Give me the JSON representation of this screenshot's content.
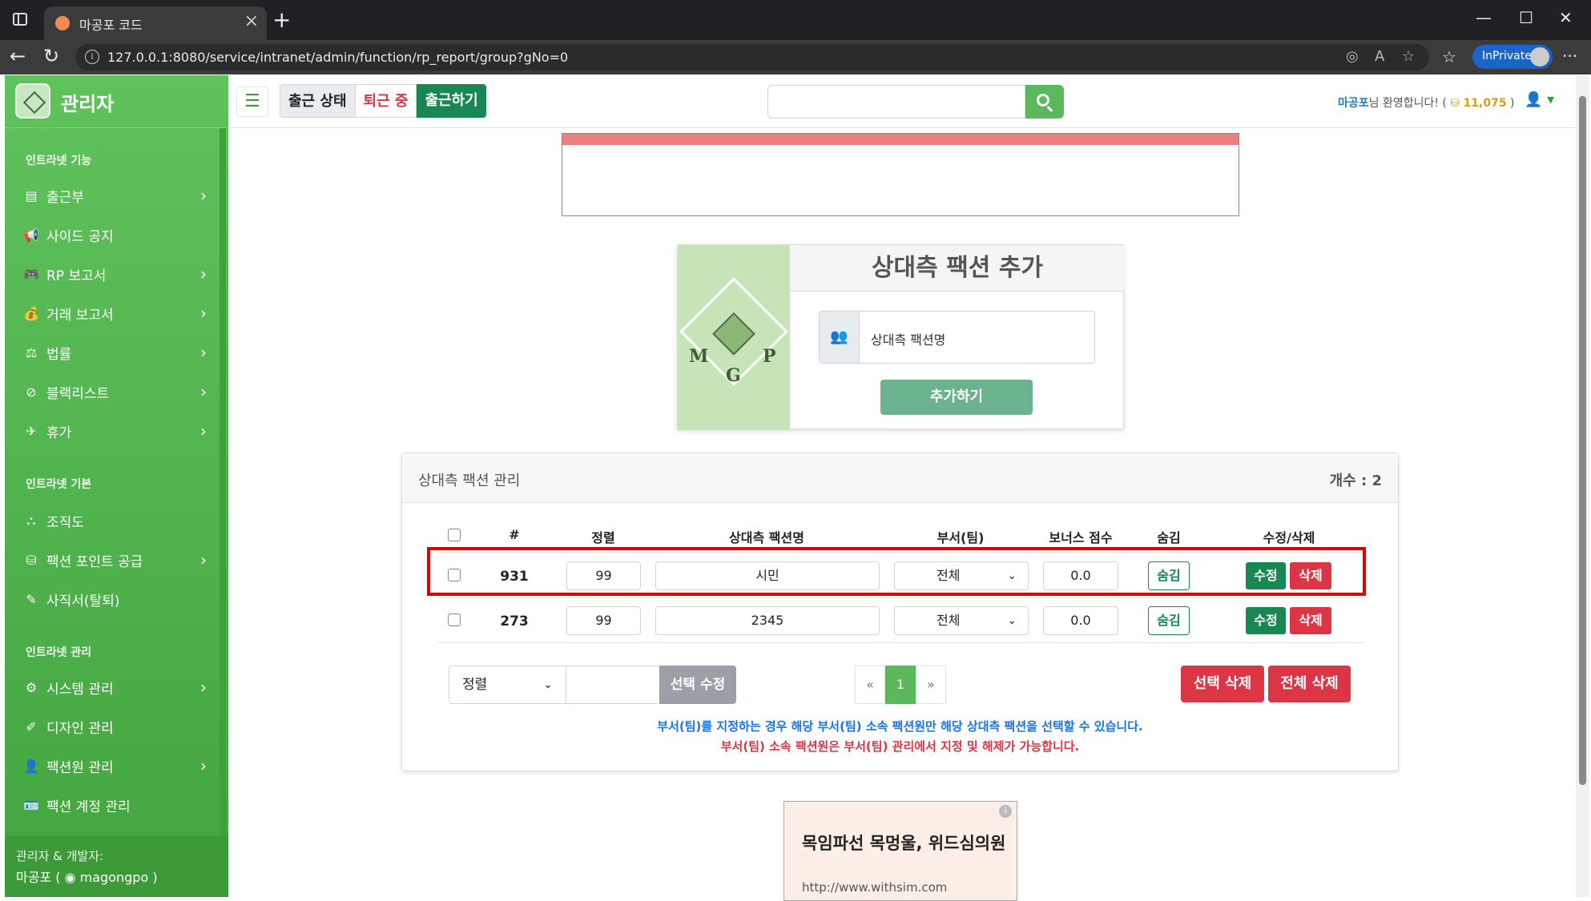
{
  "browser": {
    "tab_title": "마공포 코드",
    "url": "127.0.0.1:8080/service/intranet/admin/function/rp_report/group?gNo=0",
    "inprivate_label": "InPrivate"
  },
  "sidebar": {
    "brand": "관리자",
    "sections": [
      {
        "title": "인트라넷 기능",
        "items": [
          {
            "label": "출근부",
            "icon": "book-icon",
            "has_children": true
          },
          {
            "label": "사이드 공지",
            "icon": "megaphone-icon",
            "has_children": false
          },
          {
            "label": "RP 보고서",
            "icon": "gamepad-icon",
            "has_children": true
          },
          {
            "label": "거래 보고서",
            "icon": "money-bag-icon",
            "has_children": true
          },
          {
            "label": "법률",
            "icon": "scale-icon",
            "has_children": true
          },
          {
            "label": "블랙리스트",
            "icon": "ban-icon",
            "has_children": true
          },
          {
            "label": "휴가",
            "icon": "plane-icon",
            "has_children": true
          }
        ]
      },
      {
        "title": "인트라넷 기본",
        "items": [
          {
            "label": "조직도",
            "icon": "sitemap-icon",
            "has_children": false
          },
          {
            "label": "팩션 포인트 공급",
            "icon": "coins-icon",
            "has_children": true
          },
          {
            "label": "사직서(탈퇴)",
            "icon": "pen-icon",
            "has_children": false
          }
        ]
      },
      {
        "title": "인트라넷 관리",
        "items": [
          {
            "label": "시스템 관리",
            "icon": "gear-icon",
            "has_children": true
          },
          {
            "label": "디자인 관리",
            "icon": "brush-icon",
            "has_children": false
          },
          {
            "label": "팩션원 관리",
            "icon": "user-gear-icon",
            "has_children": true
          },
          {
            "label": "팩션 계정 관리",
            "icon": "id-card-icon",
            "has_children": false
          }
        ]
      }
    ],
    "footer": {
      "line1": "관리자 & 개발자:",
      "name": "마공포 (",
      "handle": "magongpo )"
    }
  },
  "topnav": {
    "status_label": "출근 상태",
    "status_value": "퇴근 중",
    "checkin_button": "출근하기",
    "welcome_name": "마공포",
    "welcome_text": "님 환영합니다! (",
    "points": "11,075",
    "welcome_close": ")"
  },
  "add_card": {
    "title": "상대측 팩션 추가",
    "input_placeholder": "상대측 팩션명",
    "add_button": "추가하기"
  },
  "manage_card": {
    "title": "상대측 팩션 관리",
    "count_label": "개수 : 2",
    "columns": [
      "#",
      "정렬",
      "상대측 팩션명",
      "부서(팀)",
      "보너스 점수",
      "숨김",
      "수정/삭제"
    ],
    "rows": [
      {
        "id": "931",
        "sort": "99",
        "name": "시민",
        "dept": "전체",
        "bonus": "0.0",
        "hide": "숨김",
        "edit": "수정",
        "delete": "삭제"
      },
      {
        "id": "273",
        "sort": "99",
        "name": "2345",
        "dept": "전체",
        "bonus": "0.0",
        "hide": "숨김",
        "edit": "수정",
        "delete": "삭제"
      }
    ],
    "sort_select": "정렬",
    "selected_edit": "선택 수정",
    "pager": {
      "prev": "«",
      "current": "1",
      "next": "»"
    },
    "delete_selected": "선택 삭제",
    "delete_all": "전체 삭제",
    "note_blue": "부서(팀)를 지정하는 경우 해당 부서(팀) 소속 팩션원만 해당 상대측 팩션을 선택할 수 있습니다.",
    "note_red": "부서(팀) 소속 팩션원은 부서(팀) 관리에서 지정 및 해제가 가능합니다."
  },
  "ad": {
    "headline": "목임파선 목멍울, 위드심의원",
    "url": "http://www.withsim.com"
  },
  "colors": {
    "sidebar_green": "#4caf50",
    "success": "#198754",
    "danger": "#dc3545",
    "info_blue": "#1a73e8"
  }
}
